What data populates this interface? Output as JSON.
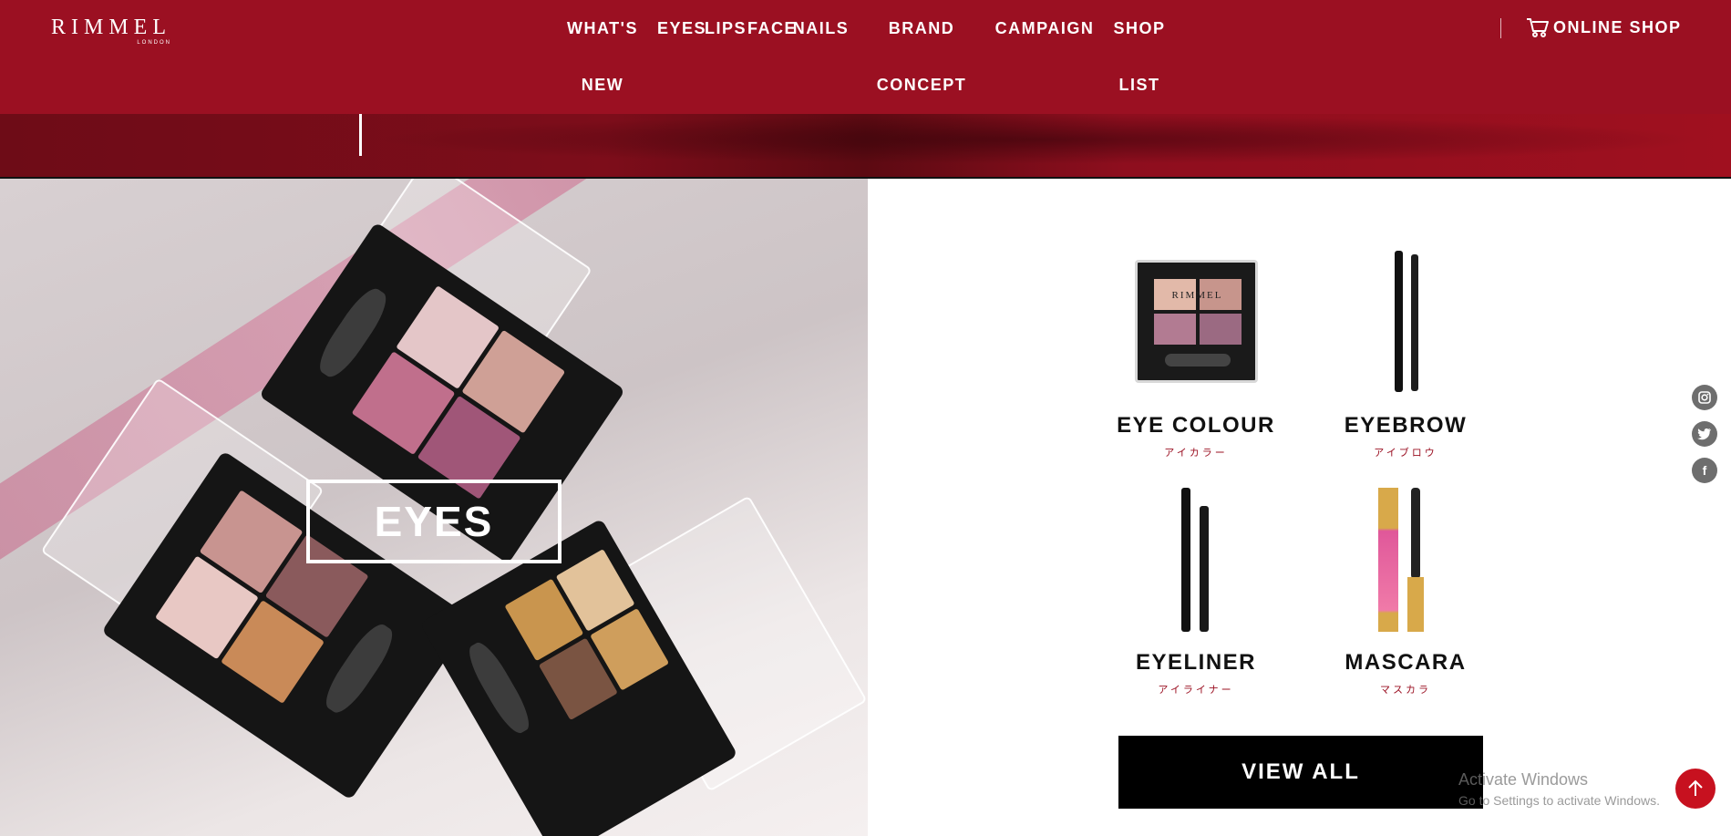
{
  "brand": {
    "logo": "RIMMEL",
    "logo_sub": "LONDON"
  },
  "nav": {
    "items": [
      {
        "label": "WHAT'S NEW"
      },
      {
        "label": "EYES"
      },
      {
        "label": "LIPS"
      },
      {
        "label": "FACE"
      },
      {
        "label": "NAILS"
      },
      {
        "label": "BRAND CONCEPT"
      },
      {
        "label": "CAMPAIGN"
      },
      {
        "label": "SHOP LIST"
      }
    ],
    "online_shop": "ONLINE SHOP"
  },
  "colors": {
    "brand_red": "#9b1022",
    "black": "#000000",
    "back_to_top": "#c7111f"
  },
  "hero": {
    "title": "EYES"
  },
  "products": [
    {
      "name": "EYE COLOUR",
      "sub": "アイカラー",
      "palette_brand": "RIMMEL",
      "icon": "eyeshadow-palette"
    },
    {
      "name": "EYEBROW",
      "sub": "アイブロウ",
      "icon": "eyebrow-pencil"
    },
    {
      "name": "EYELINER",
      "sub": "アイライナー",
      "icon": "eyeliner-pen"
    },
    {
      "name": "MASCARA",
      "sub": "マスカラ",
      "icon": "mascara-wand"
    }
  ],
  "view_all": "VIEW ALL",
  "social": [
    "instagram-icon",
    "twitter-icon",
    "facebook-icon"
  ],
  "watermark": {
    "title": "Activate Windows",
    "subtitle": "Go to Settings to activate Windows."
  }
}
